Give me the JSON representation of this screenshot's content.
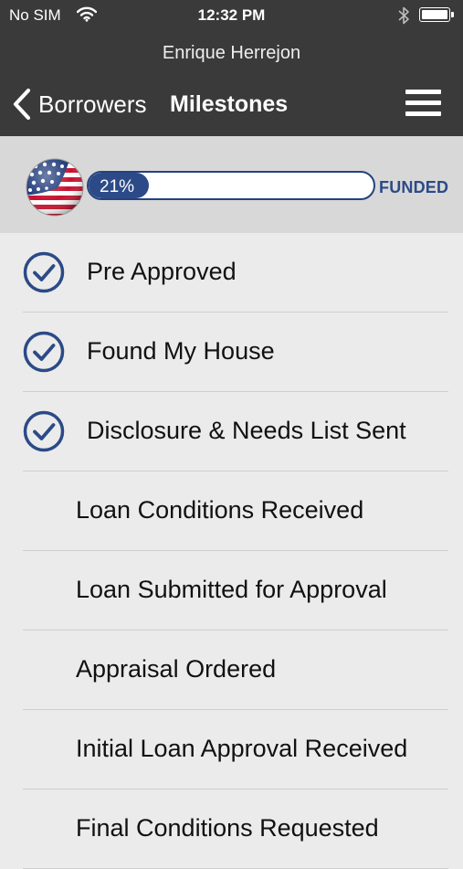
{
  "status_bar": {
    "carrier": "No SIM",
    "time": "12:32 PM"
  },
  "header": {
    "user_name": "Enrique Herrejon",
    "back_label": "Borrowers",
    "title": "Milestones"
  },
  "progress": {
    "percent": 21,
    "percent_label": "21%",
    "status_label": "FUNDED"
  },
  "colors": {
    "accent": "#2c4a87",
    "header_bg": "#3a3a3a",
    "progress_bg": "#d8d8d8",
    "list_bg": "#ebebeb"
  },
  "milestones": [
    {
      "label": "Pre Approved",
      "completed": true
    },
    {
      "label": "Found My House",
      "completed": true
    },
    {
      "label": "Disclosure & Needs List Sent",
      "completed": true
    },
    {
      "label": "Loan Conditions Received",
      "completed": false
    },
    {
      "label": "Loan Submitted for Approval",
      "completed": false
    },
    {
      "label": "Appraisal Ordered",
      "completed": false
    },
    {
      "label": "Initial Loan Approval Received",
      "completed": false
    },
    {
      "label": "Final Conditions Requested",
      "completed": false
    }
  ]
}
